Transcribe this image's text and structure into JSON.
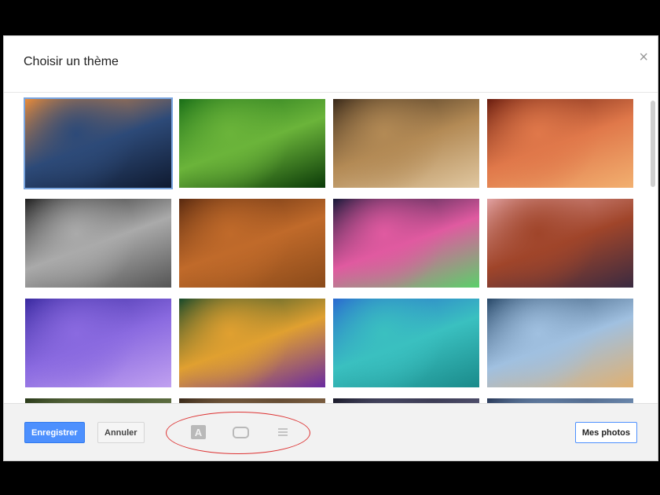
{
  "dialog": {
    "title": "Choisir un thème",
    "close_glyph": "×"
  },
  "thumbnails": [
    {
      "name": "sunset-mountains",
      "colors": [
        "#e68a3a",
        "#2d4a78",
        "#0f1a30"
      ],
      "selected": true
    },
    {
      "name": "caterpillar",
      "colors": [
        "#1a6f18",
        "#6bb43a",
        "#0b3a08"
      ],
      "selected": false
    },
    {
      "name": "chess-pieces",
      "colors": [
        "#3a2a1a",
        "#b38a55",
        "#e0c7a0"
      ],
      "selected": false
    },
    {
      "name": "red-canyon",
      "colors": [
        "#6b1e10",
        "#e0784a",
        "#f2b070"
      ],
      "selected": false
    },
    {
      "name": "metal-pipes",
      "colors": [
        "#222222",
        "#aaaaaa",
        "#555555"
      ],
      "selected": false
    },
    {
      "name": "autumn-leaves",
      "colors": [
        "#5a2a10",
        "#c06a2a",
        "#8a4a1a"
      ],
      "selected": false
    },
    {
      "name": "bokeh-lights",
      "colors": [
        "#1a1a3a",
        "#e05aa0",
        "#5ad06a"
      ],
      "selected": false
    },
    {
      "name": "river-canyon",
      "colors": [
        "#e0a0a0",
        "#a0452a",
        "#3a2a40"
      ],
      "selected": false
    },
    {
      "name": "jellyfish",
      "colors": [
        "#3a2aa0",
        "#8a6ae0",
        "#c0a0f0"
      ],
      "selected": false
    },
    {
      "name": "soap-bubble",
      "colors": [
        "#1a4a2a",
        "#e0a030",
        "#6a2aa0"
      ],
      "selected": false
    },
    {
      "name": "turquoise-lake",
      "colors": [
        "#2a6ad0",
        "#3ac0c0",
        "#1a8a8a"
      ],
      "selected": false
    },
    {
      "name": "beach-sky",
      "colors": [
        "#2a4a6a",
        "#a0c0e0",
        "#e0b070"
      ],
      "selected": false
    },
    {
      "name": "partial-1",
      "colors": [
        "#2a3a1a",
        "#6a7a4a",
        "#3a4a2a"
      ],
      "selected": false
    },
    {
      "name": "partial-2",
      "colors": [
        "#3a2a1a",
        "#8a6a4a",
        "#5a4a3a"
      ],
      "selected": false
    },
    {
      "name": "partial-3",
      "colors": [
        "#1a1a2a",
        "#5a5a7a",
        "#3a3a5a"
      ],
      "selected": false
    },
    {
      "name": "partial-4",
      "colors": [
        "#2a3a5a",
        "#7a9ac0",
        "#4a6a8a"
      ],
      "selected": false
    }
  ],
  "footer": {
    "save_label": "Enregistrer",
    "cancel_label": "Annuler",
    "my_photos_label": "Mes photos",
    "icons": [
      "text-color-icon",
      "speech-bubble-icon",
      "lines-icon"
    ],
    "text_icon_glyph": "A"
  },
  "colors": {
    "primary": "#4d90fe",
    "annotation": "#dd3333"
  }
}
